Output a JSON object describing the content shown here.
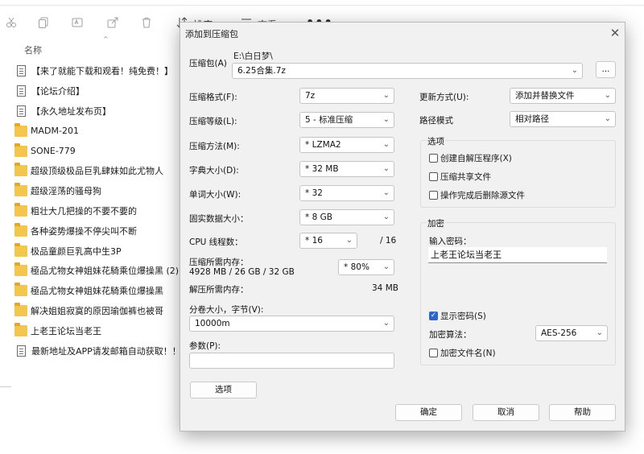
{
  "explorer": {
    "toolbar": {
      "sort_label": "排序",
      "view_label": "查看",
      "more_label": "•••"
    },
    "column_header": "名称",
    "files": [
      {
        "type": "doc",
        "name": "【来了就能下载和观看！纯免费！】"
      },
      {
        "type": "doc",
        "name": "【论坛介绍】"
      },
      {
        "type": "doc",
        "name": "【永久地址发布页】"
      },
      {
        "type": "folder",
        "name": "MADM-201"
      },
      {
        "type": "folder",
        "name": "SONE-779"
      },
      {
        "type": "folder",
        "name": "超级顶级极品巨乳肆妹如此尤物人"
      },
      {
        "type": "folder",
        "name": "超级淫荡的骚母狗"
      },
      {
        "type": "folder",
        "name": "粗壮大几把操的不要不要的"
      },
      {
        "type": "folder",
        "name": "各种姿势爆操不停尖叫不断"
      },
      {
        "type": "folder",
        "name": "极品童颜巨乳高中生3P"
      },
      {
        "type": "folder",
        "name": "極品尤物女神姐妹花騎乘位爆操黑 (2)"
      },
      {
        "type": "folder",
        "name": "極品尤物女神姐妹花騎乘位爆操黑"
      },
      {
        "type": "folder",
        "name": "解决姐姐寂寞的原因瑜伽裤也被哥"
      },
      {
        "type": "folder",
        "name": "上老王论坛当老王"
      },
      {
        "type": "doc",
        "name": "最新地址及APP请发邮箱自动获取！！！"
      }
    ]
  },
  "dialog": {
    "title": "添加到压缩包",
    "archive": {
      "label": "压缩包(A)",
      "path": "E:\\白日梦\\",
      "value": "6.25合集.7z",
      "browse_label": "..."
    },
    "format": {
      "label": "压缩格式(F):",
      "value": "7z"
    },
    "level": {
      "label": "压缩等级(L):",
      "value": "5 - 标准压缩"
    },
    "method": {
      "label": "压缩方法(M):",
      "value": "* LZMA2"
    },
    "dict": {
      "label": "字典大小(D):",
      "value": "* 32 MB"
    },
    "word": {
      "label": "单词大小(W):",
      "value": "* 32"
    },
    "solid": {
      "label": "固实数据大小：",
      "value": "* 8 GB"
    },
    "cpu": {
      "label": "CPU 线程数：",
      "value": "* 16",
      "max": "/ 16"
    },
    "mem_compress": {
      "label": "压缩所需内存：",
      "detail": "4928 MB / 26 GB / 32 GB",
      "value": "* 80%"
    },
    "mem_decompress": {
      "label": "解压所需内存：",
      "value": "34 MB"
    },
    "split": {
      "label": "分卷大小，字节(V):",
      "value": "10000m"
    },
    "params": {
      "label": "参数(P):",
      "value": ""
    },
    "options_button": "选项",
    "update": {
      "label": "更新方式(U):",
      "value": "添加并替换文件"
    },
    "path_mode": {
      "label": "路径模式",
      "value": "相对路径"
    },
    "options_group": {
      "title": "选项",
      "items": [
        {
          "label": "创建自解压程序(X)",
          "checked": false
        },
        {
          "label": "压缩共享文件",
          "checked": false
        },
        {
          "label": "操作完成后删除源文件",
          "checked": false
        }
      ]
    },
    "encryption": {
      "title": "加密",
      "password_label": "输入密码：",
      "password_value": "上老王论坛当老王",
      "show_password": {
        "label": "显示密码(S)",
        "checked": true
      },
      "method_label": "加密算法：",
      "method_value": "AES-256",
      "encrypt_names": {
        "label": "加密文件名(N)",
        "checked": false
      }
    },
    "buttons": {
      "ok": "确定",
      "cancel": "取消",
      "help": "帮助"
    }
  },
  "colors": {
    "accent": "#2f64c8",
    "folder": "#f3c74d",
    "dialog_bg": "#f1f1f1"
  }
}
